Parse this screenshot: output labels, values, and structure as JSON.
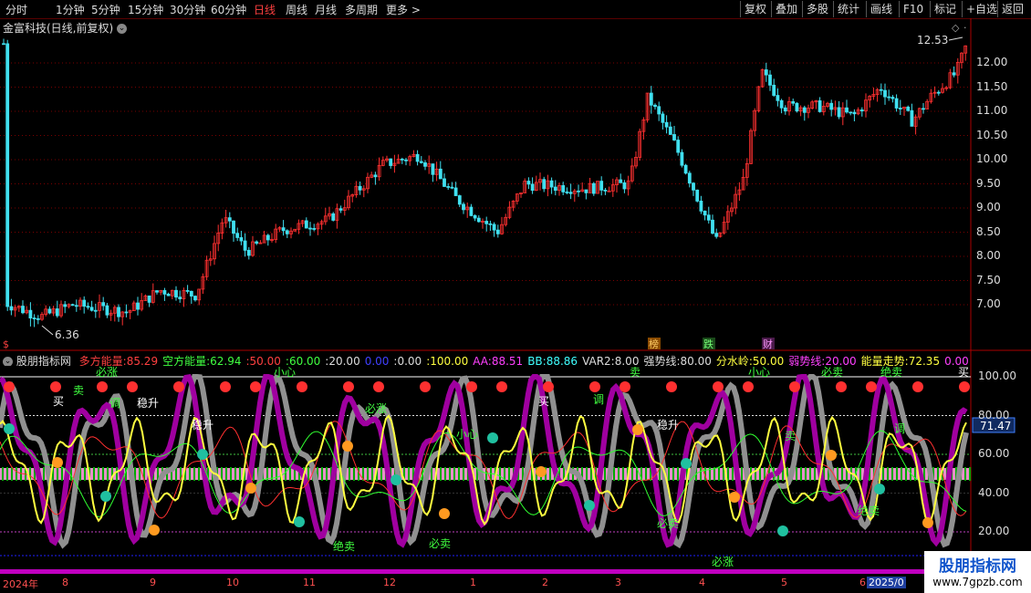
{
  "toolbar": {
    "periods": [
      "分时",
      "1分钟",
      "5分钟",
      "15分钟",
      "30分钟",
      "60分钟",
      "日线",
      "周线",
      "月线",
      "多周期",
      "更多 >"
    ],
    "active": "日线",
    "right": [
      "复权",
      "叠加",
      "多股",
      "统计",
      "画线",
      "F10",
      "标记",
      "+自选",
      "返回"
    ]
  },
  "kline": {
    "title": "金富科技(日线,前复权)",
    "y_ticks": [
      "12.00",
      "11.50",
      "11.00",
      "10.50",
      "10.00",
      "9.50",
      "9.00",
      "8.50",
      "8.00",
      "7.50",
      "7.00"
    ],
    "high_label": "12.53",
    "low_label": "6.36",
    "mini_label": "$",
    "event_tags": [
      "榜",
      "跌",
      "财"
    ]
  },
  "indicator": {
    "name": "股朋指标网",
    "values": [
      {
        "label": "多方能量:",
        "value": "85.29",
        "color": "#ff4040"
      },
      {
        "label": "空方能量:",
        "value": "62.94",
        "color": "#40ff40"
      },
      {
        "label": ":",
        "value": "50.00",
        "color": "#ff4040"
      },
      {
        "label": ":",
        "value": "60.00",
        "color": "#40ff40"
      },
      {
        "label": ":",
        "value": "20.00",
        "color": "#dddddd"
      },
      {
        "label": "",
        "value": "0.00",
        "color": "#4040ff"
      },
      {
        "label": ":",
        "value": "0.00",
        "color": "#dddddd"
      },
      {
        "label": ":",
        "value": "100.00",
        "color": "#ffff40"
      },
      {
        "label": "AA:",
        "value": "88.51",
        "color": "#ff40ff"
      },
      {
        "label": "BB:",
        "value": "88.86",
        "color": "#40ffff"
      },
      {
        "label": "VAR2:",
        "value": "8.00",
        "color": "#dddddd"
      },
      {
        "label": "强势线:",
        "value": "80.00",
        "color": "#dddddd"
      },
      {
        "label": "分水岭:",
        "value": "50.00",
        "color": "#ffff40"
      },
      {
        "label": "弱势线:",
        "value": "20.00",
        "color": "#ff40ff"
      },
      {
        "label": "能量走势:",
        "value": "72.35",
        "color": "#ffff40"
      },
      {
        "label": "",
        "value": "0.00",
        "color": "#ff40ff"
      }
    ],
    "y_ticks": [
      "100.00",
      "80.00",
      "60.00",
      "40.00",
      "20.00"
    ],
    "current_value": "71.47",
    "signals": [
      "买",
      "卖",
      "调",
      "稳升",
      "必涨",
      "小心",
      "必卖",
      "绝卖"
    ]
  },
  "x_axis": [
    "2024年",
    "8",
    "9",
    "10",
    "11",
    "12",
    "1",
    "2",
    "3",
    "4",
    "5",
    "6",
    "2025/0"
  ],
  "watermark": {
    "title": "股朋指标网",
    "url": "www.7gpzb.com"
  },
  "colors": {
    "up": "#ff3030",
    "down": "#40e0f0",
    "energy": "#ffff40",
    "bull": "#a000a0",
    "bear": "#909090"
  }
}
